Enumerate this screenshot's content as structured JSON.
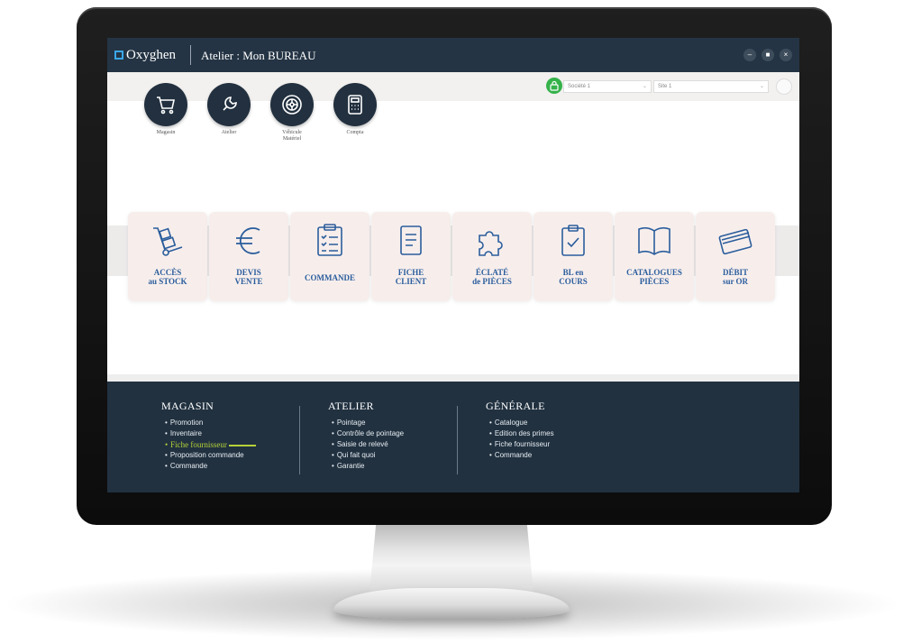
{
  "window": {
    "brand": "Oxyghen",
    "title": "Atelier : Mon BUREAU",
    "controls": [
      "minimize",
      "maximize",
      "close"
    ]
  },
  "toolbar": {
    "company_select": {
      "value": "Société 1"
    },
    "site_select": {
      "value": "Site 1"
    }
  },
  "modules": [
    {
      "icon": "shopping-cart-icon",
      "label": "Magasin"
    },
    {
      "icon": "wrench-icon",
      "label": "Atelier"
    },
    {
      "icon": "wheel-icon",
      "label": "Véhicule\nMatériel"
    },
    {
      "icon": "calculator-icon",
      "label": "Compta"
    }
  ],
  "tiles": [
    {
      "icon": "hand-truck-icon",
      "label": "ACCÈS\nau STOCK"
    },
    {
      "icon": "euro-icon",
      "label": "DEVIS\nVENTE"
    },
    {
      "icon": "checklist-icon",
      "label": "COMMANDE"
    },
    {
      "icon": "document-icon",
      "label": "FICHE\nCLIENT"
    },
    {
      "icon": "puzzle-icon",
      "label": "ÉCLATÉ\nde PIÈCES"
    },
    {
      "icon": "clipboard-check-icon",
      "label": "BL en\nCOURS"
    },
    {
      "icon": "open-book-icon",
      "label": "CATALOGUES\nPIÈCES"
    },
    {
      "icon": "credit-card-icon",
      "label": "DÉBIT\nsur OR"
    }
  ],
  "footer": {
    "columns": [
      {
        "title": "MAGASIN",
        "items": [
          "Promotion",
          "Inventaire",
          "Fiche fournisseur",
          "Proposition commande",
          "Commande"
        ],
        "active_index": 2
      },
      {
        "title": "ATELIER",
        "items": [
          "Pointage",
          "Contrôle de pointage",
          "Saisie de relevé",
          "Qui fait quoi",
          "Garantie"
        ]
      },
      {
        "title": "GÉNÉRALE",
        "items": [
          "Catalogue",
          "Edition des primes",
          "Fiche fournisseur",
          "Commande"
        ]
      }
    ]
  },
  "colors": {
    "titlebar": "#243444",
    "footer": "#213140",
    "accent_blue": "#2b5d9c",
    "active_link": "#b5d238",
    "module_circle": "#22303f",
    "tile_bg": "#f7eeec",
    "status_green": "#35b24a"
  }
}
